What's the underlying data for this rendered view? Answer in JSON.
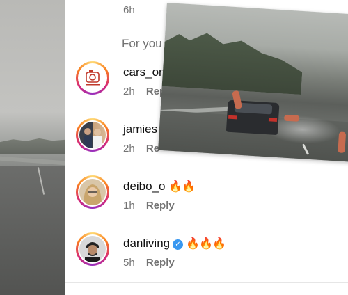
{
  "top_item": {
    "time": "6h"
  },
  "section_label": "For you",
  "comments": [
    {
      "username": "cars_on",
      "time": "2h",
      "reply": "Reply",
      "text": ""
    },
    {
      "username": "jamies",
      "time": "2h",
      "reply": "Re",
      "text": ""
    },
    {
      "username": "deibo_o",
      "time": "1h",
      "reply": "Reply",
      "text": "🔥🔥"
    },
    {
      "username": "danliving",
      "time": "5h",
      "reply": "Reply",
      "text": "🔥🔥🔥",
      "verified": true
    }
  ],
  "icons": {
    "verified": "verified-badge-icon",
    "camera_logo": "camera-logo-icon"
  },
  "colors": {
    "story_ring": "#d62976",
    "muted_text": "#737373",
    "verified_blue": "#3897f0"
  }
}
